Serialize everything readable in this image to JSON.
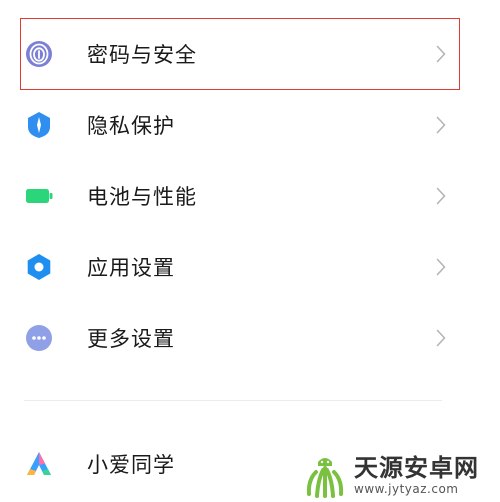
{
  "settings": {
    "items": [
      {
        "label": "密码与安全",
        "icon": "fingerprint-icon",
        "color": "#7b7fd6"
      },
      {
        "label": "隐私保护",
        "icon": "privacy-shield-icon",
        "color": "#2f8ff0"
      },
      {
        "label": "电池与性能",
        "icon": "battery-icon",
        "color": "#2bd67b"
      },
      {
        "label": "应用设置",
        "icon": "gear-icon",
        "color": "#1f8ef1"
      },
      {
        "label": "更多设置",
        "icon": "more-dots-icon",
        "color": "#8fa0e6"
      },
      {
        "label": "小爱同学",
        "icon": "xiaoai-icon",
        "color": "#3aa0ff"
      }
    ]
  },
  "colors": {
    "highlight_border": "#e53935",
    "chevron": "#b5b5b5",
    "divider": "#ececec"
  },
  "watermark": {
    "title": "天源安卓网",
    "url": "www.jytyaz.com"
  }
}
